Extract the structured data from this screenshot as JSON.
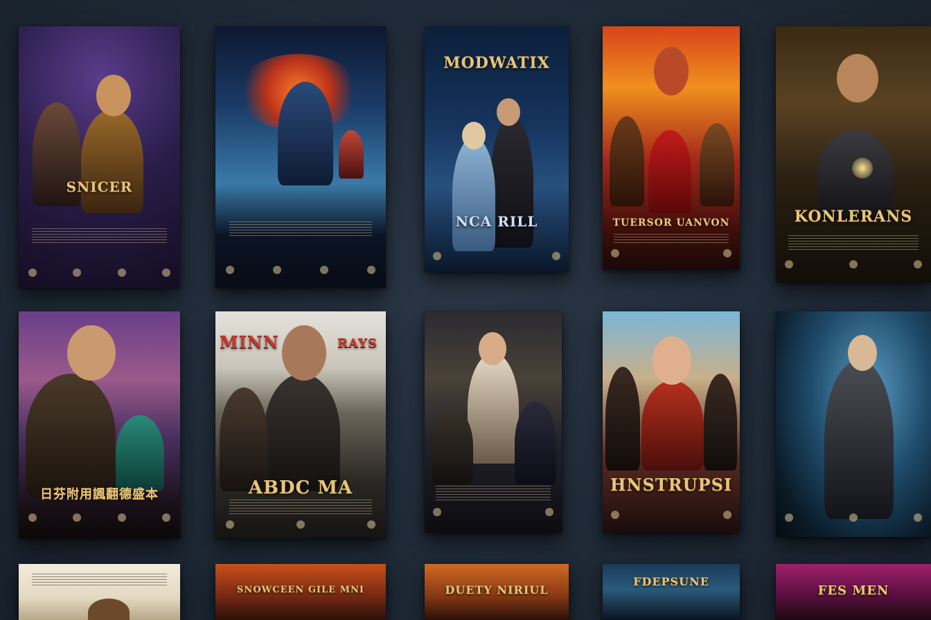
{
  "posters": [
    {
      "id": "p1",
      "title": "SNICER"
    },
    {
      "id": "p2",
      "title": ""
    },
    {
      "id": "p3",
      "title": "MODWATIX",
      "subtitle": "NCA RILL"
    },
    {
      "id": "p4",
      "title": "TUERSOR UANVON"
    },
    {
      "id": "p5",
      "title": "KONLERANS"
    },
    {
      "id": "p6",
      "title": "日芬附用諷翻德盛本"
    },
    {
      "id": "p7",
      "title": "MINN",
      "title2": "RAYS",
      "subtitle": "ABDC MA"
    },
    {
      "id": "p8",
      "title": ""
    },
    {
      "id": "p9",
      "title": "HNSTRUPSI"
    },
    {
      "id": "p10",
      "title": ""
    },
    {
      "id": "p11",
      "title": ""
    },
    {
      "id": "p12",
      "title": "SNOWCEEN GILE MNI"
    },
    {
      "id": "p13",
      "title": "DUETY NIRIUL"
    },
    {
      "id": "p14",
      "title": "FDEPSUNE"
    },
    {
      "id": "p15",
      "title": "FES MEN"
    }
  ],
  "colors": {
    "background": "#1f2a37"
  }
}
